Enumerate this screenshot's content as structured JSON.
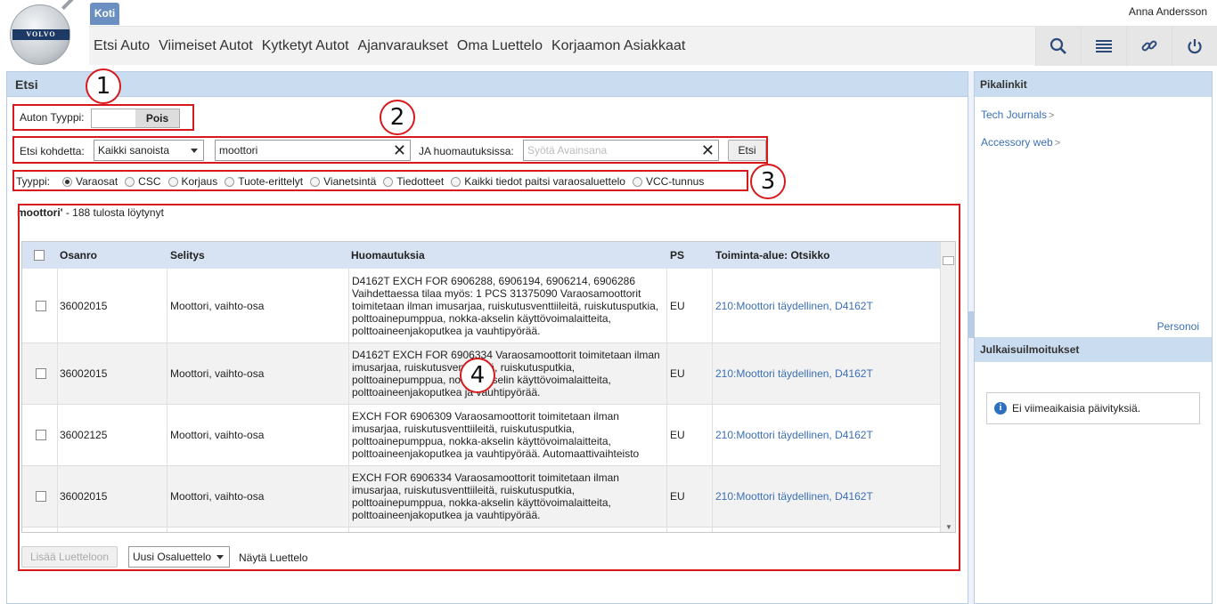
{
  "header": {
    "logo_text": "VOLVO",
    "home_tab": "Koti",
    "user": "Anna Andersson",
    "nav": [
      "Etsi Auto",
      "Viimeiset Autot",
      "Kytketyt Autot",
      "Ajanvaraukset",
      "Oma Luettelo",
      "Korjaamon Asiakkaat"
    ],
    "icons": [
      "search-icon",
      "list-icon",
      "link-icon",
      "power-icon"
    ]
  },
  "search": {
    "title": "Etsi",
    "car_type_label": "Auton Tyyppi:",
    "car_type_toggle": "Pois",
    "search_target_label": "Etsi kohdetta:",
    "search_target_value": "Kaikki sanoista",
    "query_value": "moottori",
    "remarks_label": "JA huomautuksissa:",
    "remarks_placeholder": "Syötä Avainsana",
    "search_button": "Etsi",
    "type_label": "Tyyppi:",
    "types": [
      "Varaosat",
      "CSC",
      "Korjaus",
      "Tuote-erittelyt",
      "Vianetsintä",
      "Tiedotteet",
      "Kaikki tiedot paitsi varaosaluettelo",
      "VCC-tunnus"
    ],
    "selected_type": "Varaosat",
    "result_term": "moottori'",
    "result_text": " - 188 tulosta löytynyt"
  },
  "table": {
    "headers": [
      "Osanro",
      "Selitys",
      "Huomautuksia",
      "PS",
      "Toiminta-alue: Otsikko"
    ],
    "rows": [
      {
        "part": "36002015",
        "desc": "Moottori, vaihto-osa",
        "notes": "D4162T EXCH FOR  6906288, 6906194, 6906214, 6906286 Vaihdettaessa tilaa myös: 1 PCS 31375090 Varaosamoottorit toimitetaan ilman imusarjaa, ruiskutusventtiileitä, ruiskutusputkia, polttoainepumppua, nokka-akselin käyttövoimalaitteita, polttoaineenjakoputkea ja vauhtipyörää.",
        "ps": "EU",
        "area": "210:Moottori täydellinen, D4162T"
      },
      {
        "part": "36002015",
        "desc": "Moottori, vaihto-osa",
        "notes": "D4162T EXCH FOR  6906334 Varaosamoottorit toimitetaan ilman imusarjaa, ruiskutusventtiileitä, ruiskutusputkia, polttoainepumppua, nokka-akselin käyttövoimalaitteita, polttoaineenjakoputkea ja vauhtipyörää.",
        "ps": "EU",
        "area": "210:Moottori täydellinen, D4162T"
      },
      {
        "part": "36002125",
        "desc": "Moottori, vaihto-osa",
        "notes": "EXCH FOR 6906309 Varaosamoottorit toimitetaan ilman imusarjaa, ruiskutusventtiileitä, ruiskutusputkia, polttoainepumppua, nokka-akselin käyttövoimalaitteita, polttoaineenjakoputkea ja vauhtipyörää. Automaattivaihteisto",
        "ps": "EU",
        "area": "210:Moottori täydellinen, D4162T"
      },
      {
        "part": "36002015",
        "desc": "Moottori, vaihto-osa",
        "notes": "EXCH FOR  6906334 Varaosamoottorit toimitetaan ilman imusarjaa, ruiskutusventtiileitä, ruiskutusputkia, polttoainepumppua, nokka-akselin käyttövoimalaitteita, polttoaineenjakoputkea ja vauhtipyörää.",
        "ps": "EU",
        "area": "210:Moottori täydellinen, D4162T"
      }
    ]
  },
  "footer": {
    "add_button": "Lisää Luetteloon",
    "list_select": "Uusi Osaluettelo",
    "show_list": "Näytä Luettelo"
  },
  "callouts": [
    "1",
    "2",
    "3",
    "4"
  ],
  "sidebar": {
    "quicklinks_title": "Pikalinkit",
    "links": [
      "Tech Journals",
      "Accessory web"
    ],
    "personalize": "Personoi",
    "releases_title": "Julkaisuilmoitukset",
    "no_updates": "Ei viimeaikaisia päivityksiä."
  },
  "colors": {
    "accent": "#6b8fc0",
    "panel_header": "#cadcf0",
    "highlight": "#d7191c",
    "link": "#3b6fb6"
  }
}
